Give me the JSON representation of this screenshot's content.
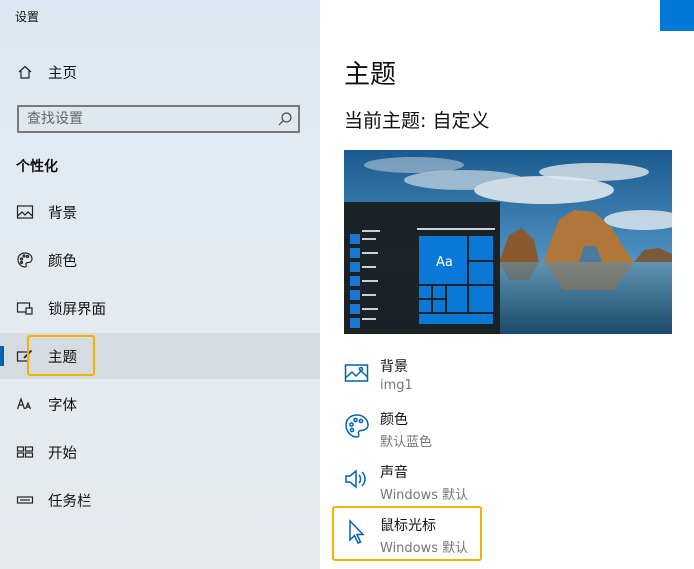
{
  "app": {
    "title": "设置"
  },
  "sidebar": {
    "home_label": "主页",
    "search": {
      "placeholder": "查找设置"
    },
    "section": "个性化",
    "items": [
      {
        "label": "背景",
        "icon": "picture-icon"
      },
      {
        "label": "颜色",
        "icon": "palette-icon"
      },
      {
        "label": "锁屏界面",
        "icon": "lock-screen-icon"
      },
      {
        "label": "主题",
        "icon": "theme-brush-icon",
        "selected": true
      },
      {
        "label": "字体",
        "icon": "font-icon"
      },
      {
        "label": "开始",
        "icon": "start-menu-icon"
      },
      {
        "label": "任务栏",
        "icon": "taskbar-icon"
      }
    ]
  },
  "main": {
    "title": "主题",
    "current_theme": "当前主题: 自定义",
    "preview": {
      "tile_text": "Aa"
    },
    "settings": [
      {
        "label": "背景",
        "value": "img1",
        "icon": "picture-icon"
      },
      {
        "label": "颜色",
        "value": "默认蓝色",
        "icon": "palette-icon"
      },
      {
        "label": "声音",
        "value": "Windows 默认",
        "icon": "speaker-icon"
      },
      {
        "label": "鼠标光标",
        "value": "Windows 默认",
        "icon": "cursor-icon"
      }
    ]
  },
  "colors": {
    "accent": "#0078d7",
    "highlight": "#f2b300",
    "tile": "#0a78d7"
  }
}
